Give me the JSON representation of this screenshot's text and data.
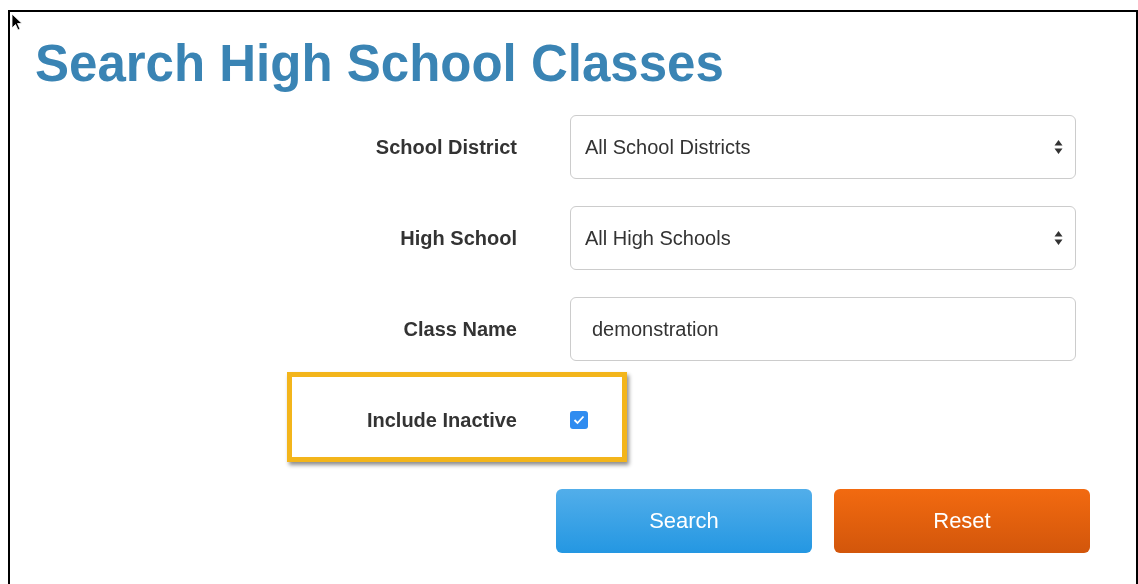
{
  "title": "Search High School Classes",
  "fields": [
    {
      "kind": "select",
      "label": "School District",
      "value": "All School Districts",
      "highlighted": false
    },
    {
      "kind": "select",
      "label": "High School",
      "value": "All High Schools",
      "highlighted": false
    },
    {
      "kind": "text",
      "label": "Class Name",
      "value": "demonstration",
      "highlighted": false
    },
    {
      "kind": "checkbox",
      "label": "Include Inactive",
      "checked": true,
      "highlighted": true
    }
  ],
  "buttons": [
    {
      "label": "Search",
      "kind": "primary"
    },
    {
      "label": "Reset",
      "kind": "danger"
    }
  ]
}
